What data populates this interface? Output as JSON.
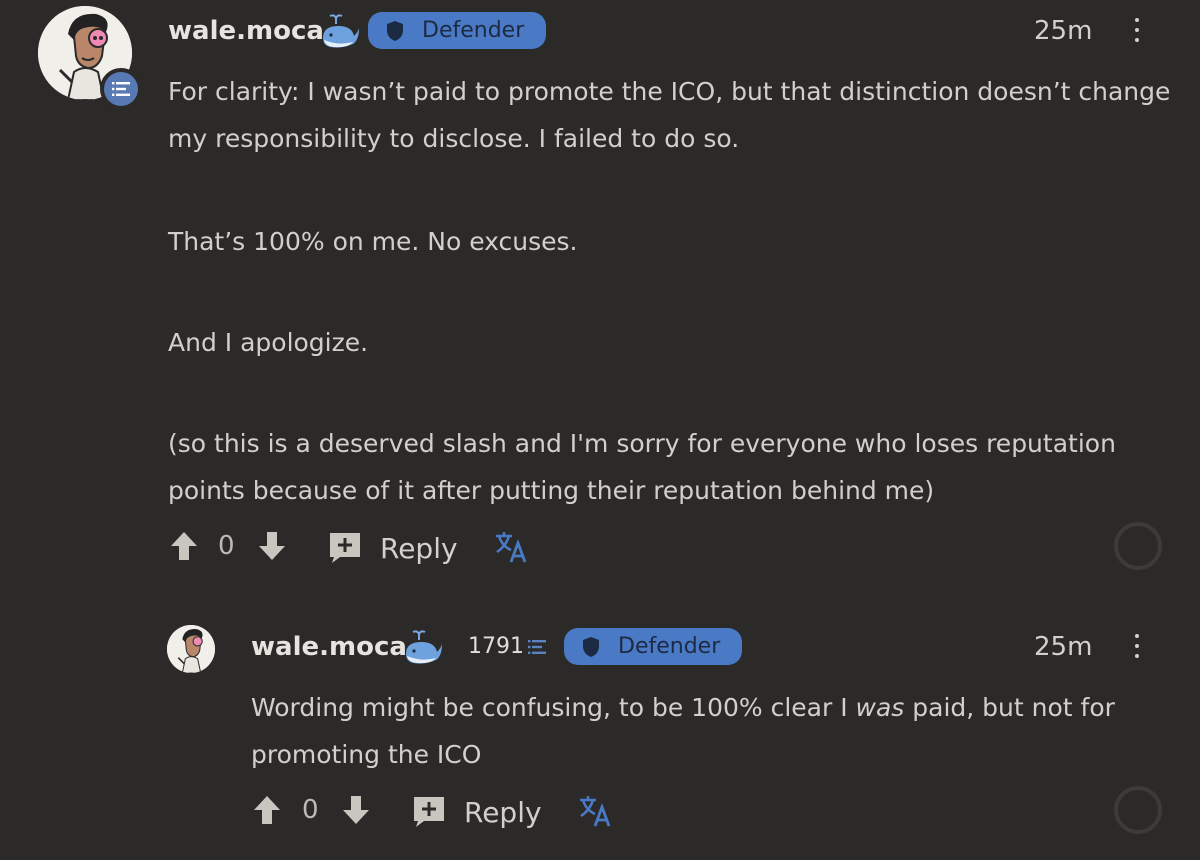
{
  "comment": {
    "username": "wale.moca",
    "badge": "Defender",
    "time": "25m",
    "paragraphs": [
      "For clarity: I wasn’t paid to promote the ICO, but that distinction doesn’t change my responsibility to disclose. I failed to do so.",
      "That’s 100% on me. No excuses.",
      "And I apologize.",
      "(so this is a deserved slash and I'm sorry for everyone who loses reputation points because of it after putting their reputation behind me)"
    ],
    "votes": "0",
    "reply_label": "Reply"
  },
  "reply": {
    "username": "wale.moca",
    "score": "1791",
    "badge": "Defender",
    "time": "25m",
    "text_before": "Wording might be confusing, to be 100% clear I ",
    "text_emph": "was",
    "text_after": " paid, but not for promoting the ICO",
    "votes": "0",
    "reply_label": "Reply"
  },
  "icons": {
    "verified": "whale-icon",
    "badge": "shield-icon",
    "level": "reputation-icon",
    "upvote": "arrow-up-icon",
    "downvote": "arrow-down-icon",
    "reply": "comment-plus-icon",
    "translate": "translate-icon",
    "menu": "more-vertical-icon"
  },
  "colors": {
    "background": "#2b2a28",
    "badge": "#4a7ac6",
    "text": "#d2d0cb"
  }
}
